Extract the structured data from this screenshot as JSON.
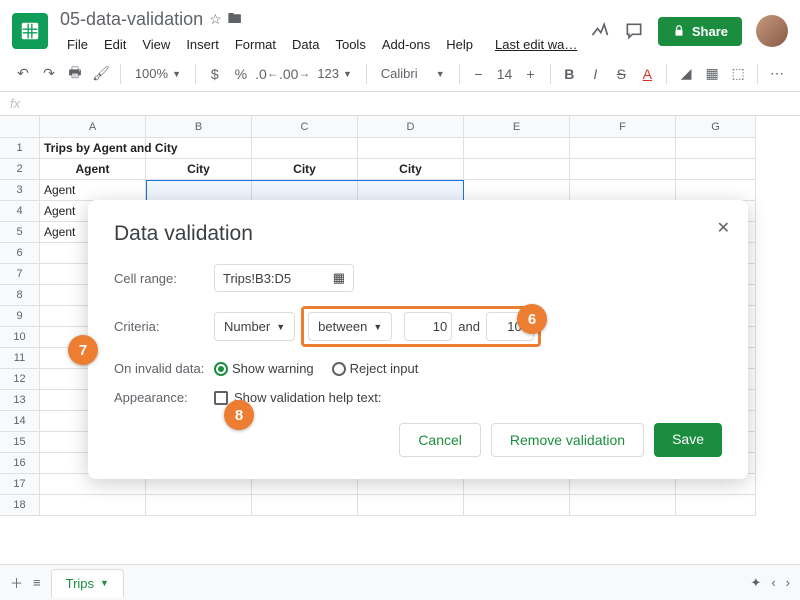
{
  "header": {
    "doc_title": "05-data-validation",
    "last_edit": "Last edit wa…",
    "share": "Share",
    "menus": [
      "File",
      "Edit",
      "View",
      "Insert",
      "Format",
      "Data",
      "Tools",
      "Add-ons",
      "Help"
    ]
  },
  "toolbar": {
    "zoom": "100%",
    "currency": "$",
    "percent": "%",
    "dec_dec": ".0",
    "dec_inc": ".00",
    "num_fmt": "123",
    "font": "Calibri",
    "size": "14"
  },
  "grid": {
    "cols": [
      "A",
      "B",
      "C",
      "D",
      "E",
      "F",
      "G"
    ],
    "rows": [
      1,
      2,
      3,
      4,
      5,
      6,
      7,
      8,
      9,
      10,
      11,
      12,
      13,
      14,
      15,
      16,
      17,
      18
    ],
    "cells": {
      "A1": "Trips by Agent and City",
      "A2": "Agent",
      "B2": "City",
      "C2": "City",
      "D2": "City",
      "A3": "Agent",
      "A4": "Agent",
      "A5": "Agent"
    },
    "selection": "B3:D5"
  },
  "dialog": {
    "title": "Data validation",
    "cell_range_label": "Cell range:",
    "cell_range_value": "Trips!B3:D5",
    "criteria_label": "Criteria:",
    "criteria_type": "Number",
    "criteria_op": "between",
    "criteria_min": "10",
    "and": "and",
    "criteria_max": "100",
    "invalid_label": "On invalid data:",
    "show_warning": "Show warning",
    "reject_input": "Reject input",
    "appearance_label": "Appearance:",
    "help_text": "Show validation help text:",
    "cancel": "Cancel",
    "remove": "Remove validation",
    "save": "Save"
  },
  "callouts": {
    "c6": "6",
    "c7": "7",
    "c8": "8"
  },
  "sheetbar": {
    "tab": "Trips"
  }
}
